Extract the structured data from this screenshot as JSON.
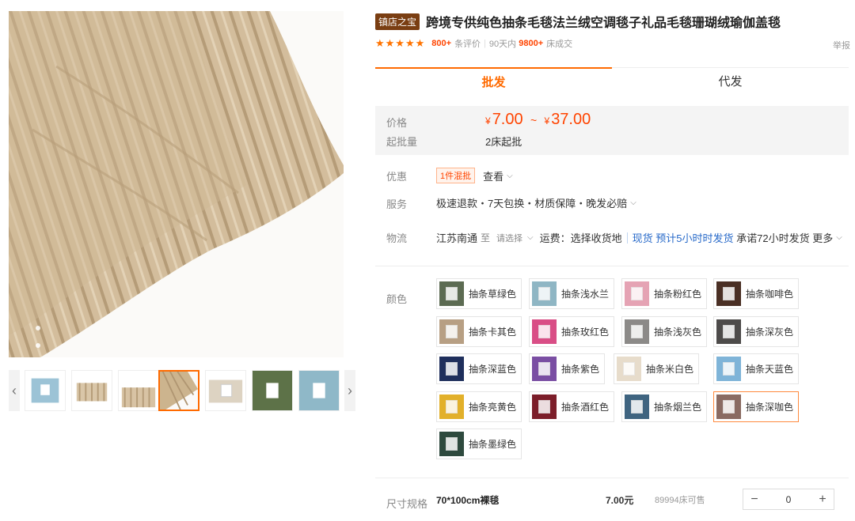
{
  "gallery": {
    "main_image_desc_icon": "fleece-blanket-image",
    "thumbnails": [
      {
        "name": "thumb-1",
        "color": "#9cc3d6"
      },
      {
        "name": "thumb-2",
        "color": "#d9c6a8"
      },
      {
        "name": "thumb-3",
        "color": "#d8c3a4"
      },
      {
        "name": "thumb-4",
        "color": "#ccb48e"
      },
      {
        "name": "thumb-5",
        "color": "#ddd3c2"
      },
      {
        "name": "thumb-6",
        "color": "#5d7248"
      },
      {
        "name": "thumb-7",
        "color": "#8fb8c8"
      }
    ],
    "prev_icon": "‹",
    "next_icon": "›"
  },
  "product": {
    "shop_badge": "镇店之宝",
    "title": "跨境专供纯色抽条毛毯法兰绒空调毯子礼品毛毯珊瑚绒瑜伽盖毯",
    "stars": "★★★★★",
    "review_count": "800+",
    "review_label": "条评价",
    "days_label": "90天内",
    "sold_count": "9800+",
    "sold_label": "床成交",
    "report_link": "举报"
  },
  "tabs": [
    {
      "label": "批发",
      "active": true
    },
    {
      "label": "代发",
      "active": false
    }
  ],
  "pricing": {
    "price_label": "价格",
    "currency": "¥",
    "price_min": "7.00",
    "price_max": "37.00",
    "tilde": "~",
    "moq_label": "起批量",
    "moq_value": "2床起批"
  },
  "discount": {
    "label": "优惠",
    "tag": "1件混批",
    "view": "查看"
  },
  "service": {
    "label": "服务",
    "value": "极速退款・7天包换・材质保障・晚发必赔"
  },
  "logistics": {
    "label": "物流",
    "origin": "江苏南通",
    "to": "至",
    "dest_placeholder": "请选择",
    "freight": "运费：选择收货地",
    "stock_status": "现货",
    "ship_estimate": "预计5小时时发货",
    "promise": "承诺72小时发货",
    "more": "更多"
  },
  "colors": {
    "label": "颜色",
    "options": [
      {
        "label": "抽条草绿色",
        "color": "#5c6b52"
      },
      {
        "label": "抽条浅水兰",
        "color": "#8fb6c4"
      },
      {
        "label": "抽条粉红色",
        "color": "#e5a3b4"
      },
      {
        "label": "抽条咖啡色",
        "color": "#4a2f24"
      },
      {
        "label": "抽条卡其色",
        "color": "#b79f83"
      },
      {
        "label": "抽条玫红色",
        "color": "#d94e86"
      },
      {
        "label": "抽条浅灰色",
        "color": "#8c8a88"
      },
      {
        "label": "抽条深灰色",
        "color": "#4d4b4a"
      },
      {
        "label": "抽条深蓝色",
        "color": "#1f2f5c"
      },
      {
        "label": "抽条紫色",
        "color": "#7a4ea3"
      },
      {
        "label": "抽条米白色",
        "color": "#e7dccb"
      },
      {
        "label": "抽条天蓝色",
        "color": "#7fb4d8"
      },
      {
        "label": "抽条亮黄色",
        "color": "#e2b02a"
      },
      {
        "label": "抽条酒红色",
        "color": "#7c1e2a"
      },
      {
        "label": "抽条烟兰色",
        "color": "#3f6480"
      },
      {
        "label": "抽条深咖色",
        "color": "#8a6b62"
      },
      {
        "label": "抽条墨绿色",
        "color": "#2e4a3e"
      }
    ],
    "selected_index": 15
  },
  "size": {
    "label": "尺寸规格",
    "spec": "70*100cm裸毯",
    "unit_price": "7.00元",
    "stock": "89994床可售",
    "minus": "−",
    "plus": "+",
    "quantity": "0"
  },
  "accent_color": "#ff6a00"
}
